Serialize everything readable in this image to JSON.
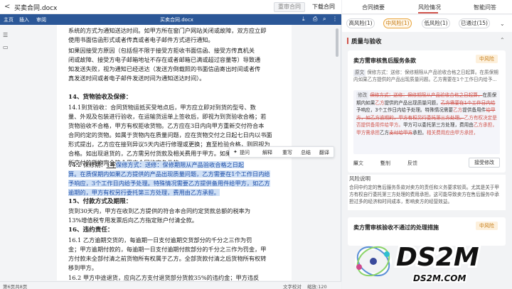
{
  "topbar": {
    "back": "<",
    "filename": "买卖合同.docx",
    "review_btn": "重审合同",
    "download_btn": "下载合同"
  },
  "toolbar": {
    "tabs": [
      "主页",
      "插入",
      "审阅"
    ],
    "doc_title": "买卖合同.docx"
  },
  "document": {
    "lines": [
      "系统的方式为通知送达时间。如甲方所在窗门户网站关闭或故障，双方应立即",
      "使用书面信函形式或者传真或者电子邮件方式进行通知。",
      "   如果因接受方原因（包括但不限于接受方拒收书面信函、接受方传真机关",
      "闭或故障、接受方电子邮箱地址不存在或者邮箱已满或超过容量等）导致通",
      "知发送失败，视为通知已经送达（发送方倒载照的书面信函寄出时间或者传",
      "真发送时间或者电子邮件发送时间为通知送达时间）。"
    ],
    "h14": "14、货物验收及保修：",
    "p14_1": [
      "   14.1到货验收：合同货物运抵买受地点后，甲方应立即对到货的型号、数",
      "量、外观及包装进行验收，在运输货运单上签收后，即视为到货验收合格；若",
      "货物验收不合格，甲方有权拒收货物。乙方应在3日内向甲方重新交付符合本",
      "合同约定的货物。如属于货物内在质量问题，应在货物交付之日起七日内以书面",
      "形式提出，乙方应在接到异议5天内进行修理或更换；直至检验合格，则同视为",
      "合格。如出现退货的，乙方需另付货款及相关费用于甲方。如果因质量问题",
      "所交付的货物完全符合甲方合同约定条件的，"
    ],
    "p14_2_prefix": "   14.2  保修期：",
    "p14_2_year": "1年",
    "p14_2_sel_start": "。保修方式：",
    "p14_2_sel_lines": [
      "保修方式：送修：保修期限从产品验收合格之日起",
      "算。在质保期内如果乙方提供的产品出现质量问题，乙方需要在1个工作日内给",
      "予响应，3个工作日内给予处理。特殊情况需要乙方提供备用件给甲方，如乙方",
      "逾期的，甲方有权另行委托第三方处理，费用由乙方承担。"
    ],
    "h15": "15、付款方式及期限：",
    "p15": [
      "   货到30天内，甲方在收到乙方提供的符合本合同约定货款总额的税率为",
      "13%增值税专用发票后向乙方指定账户付清全款。"
    ],
    "h16": "16、违约责任：",
    "p16_1": [
      "   16.1    乙方逾期交货的，每逾期一日支付逾期交货部分的千分之三作为罚",
      "金；甲方逾期付款的，每逾期一日支付逾期付款部分的千分之三作为罚金，甲",
      "方付款未全部付清之前货物所有权属于乙方。全部货款付清之后货物所有权转",
      "移到甲方。"
    ],
    "p16_2": [
      "   16.2    甲方中途退货，应向乙方支付退货部分货款35%的违约金；甲方违反",
      "合同规定拒绝接受货物的，应承担由此造成的损失。"
    ]
  },
  "floatmenu": {
    "items": [
      "提问",
      "解释",
      "重写",
      "总结",
      "翻译"
    ]
  },
  "statusbar": {
    "page": "第6页共8页",
    "words": "文字校对",
    "zoom": "缩放:120"
  },
  "panel": {
    "tabs": [
      "合同摘要",
      "风险情况",
      "智能问答"
    ],
    "filters": [
      {
        "label": "高风险(1)",
        "active": false
      },
      {
        "label": "中风险(1)",
        "active": true
      },
      {
        "label": "低风险(1)",
        "active": false
      },
      {
        "label": "已通过(15)",
        "active": false
      }
    ],
    "section_title": "质量与验收",
    "card1": {
      "title": "卖方需审核售后服务条款",
      "badge": "中风险",
      "orig_label": "原文",
      "orig_text": "保修方式：送修：保修期限从产品验收合格之日起算。在质保期内如果乙方提供的产品出现质量问题。乙方需要在1个工作日内给予...",
      "sug_label": "修改",
      "sug_del_1": "保修方式：送修：保修期限从产品验收合格之日起算，",
      "sug_text_1": "在",
      "sug_text_2": "质保期内如果",
      "sug_ins_1": "乙方",
      "sug_text_3": "提供的产品出现质量问题，",
      "sug_del_2": "乙方需要在1个工作日内给",
      "sug_text_4": "予响应，3个工作日内给予处理。特殊情况需要",
      "sug_ins_2": "乙方",
      "sug_text_5": "提供备用件",
      "sug_del_3": "给甲方，如乙方逾期的，甲方有权另行委托第三方处理。",
      "sug_ins_3": "乙方有权决定是否提供备用件给甲方。",
      "sug_text_6": "甲方可以委托第三方处理，费用由",
      "sug_ins_4": "乙方承担，甲方需承担",
      "sug_text_7": "乙方",
      "sug_del_4": "支付给甲方",
      "sug_text_8": "承担。",
      "sug_ins_5": "相关费用应由甲方承担，",
      "actions": [
        "原文",
        "复制",
        "反馈"
      ],
      "accept_btn": "接受修改"
    },
    "explain": {
      "title": "风险说明",
      "body": "合同中约定的售后服务条款对卖方的责任和义务要求较高。尤其是关于甲方有权自行委托第三方处理的费用承担。这可能导致卖方在售后服务中承担过多的经济和时间成本，影响卖方的经营效益。"
    },
    "card2": {
      "title": "卖方需审核验收不通过的处理措施",
      "badge": "中风险"
    }
  },
  "watermark": {
    "brand": "DS2M",
    "domain": "DS2M.COM"
  }
}
